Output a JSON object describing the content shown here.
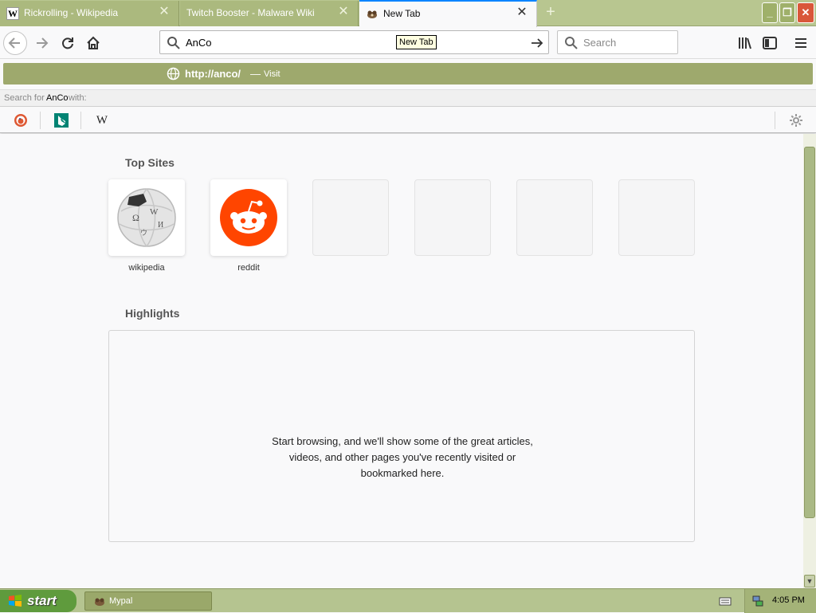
{
  "tabs": [
    {
      "title": "Rickrolling - Wikipedia",
      "icon": "wikipedia-icon",
      "active": false
    },
    {
      "title": "Twitch Booster - Malware Wiki",
      "icon": "none",
      "active": false
    },
    {
      "title": "New Tab",
      "icon": "mypal-icon",
      "active": true
    }
  ],
  "tab_close_glyph": "✕",
  "urlbar": {
    "value": "AnCo",
    "tooltip": "New Tab"
  },
  "searchbar": {
    "placeholder": "Search"
  },
  "dropdown": {
    "visit_url": "http://anco/",
    "separator": "—",
    "visit_label": "Visit",
    "search_for_prefix": "Search for",
    "search_for_query": "AnCo",
    "search_for_suffix": "with:",
    "engines": [
      "duckduckgo-icon",
      "bing-icon",
      "wikipedia-icon"
    ]
  },
  "newtab": {
    "top_sites_title": "Top Sites",
    "top_sites": [
      {
        "label": "wikipedia",
        "icon": "wikipedia-globe-icon"
      },
      {
        "label": "reddit",
        "icon": "reddit-icon"
      }
    ],
    "highlights_title": "Highlights",
    "highlights_empty_line1": "Start browsing, and we'll show some of the great articles,",
    "highlights_empty_line2": "videos, and other pages you've recently visited or",
    "highlights_empty_line3": "bookmarked here."
  },
  "taskbar": {
    "start_label": "start",
    "task_label": "Mypal",
    "clock": "4:05 PM"
  },
  "colors": {
    "accent": "#0a84ff",
    "theme_olive": "#9ea96d",
    "reddit": "#ff4500"
  }
}
